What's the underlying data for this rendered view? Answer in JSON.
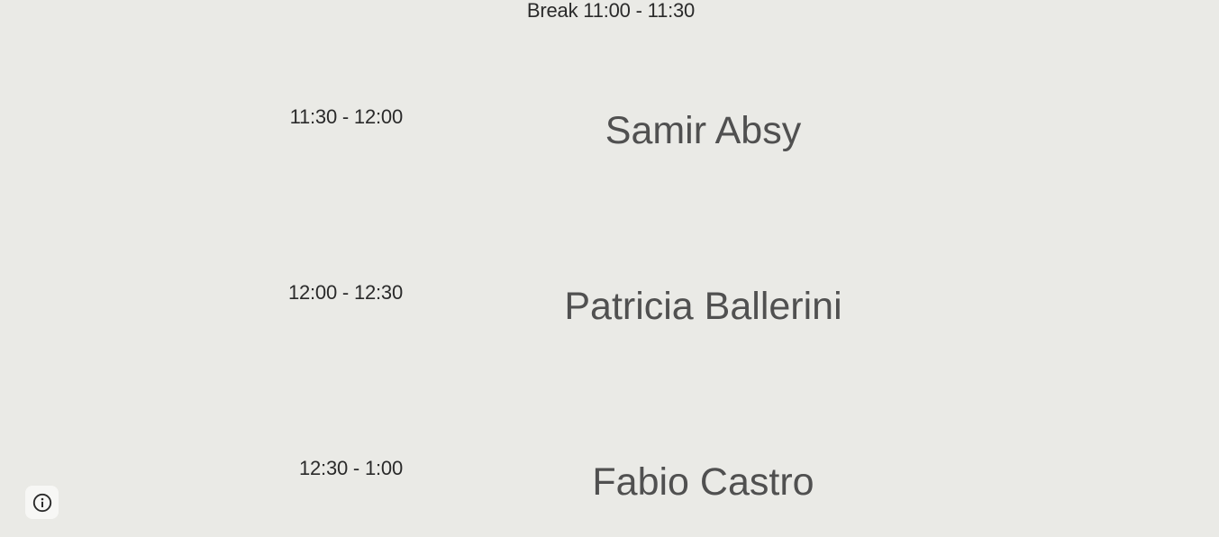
{
  "break": {
    "label": "Break 11:00 - 11:30"
  },
  "schedule": [
    {
      "time": "11:30 - 12:00",
      "speaker": "Samir Absy"
    },
    {
      "time": "12:00 - 12:30",
      "speaker": "Patricia Ballerini"
    },
    {
      "time": "12:30 - 1:00",
      "speaker": "Fabio Castro"
    }
  ],
  "info_button": {
    "icon": "info-icon"
  }
}
